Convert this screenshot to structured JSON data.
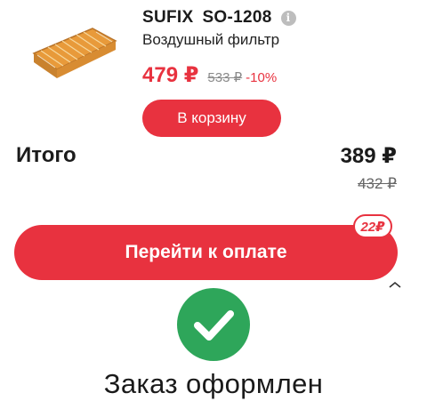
{
  "product": {
    "brand": "SUFIX",
    "sku": "SO-1208",
    "name": "Воздушный фильтр",
    "price_current": "479 ₽",
    "price_old": "533 ₽",
    "discount": "-10%",
    "add_to_cart_label": "В корзину",
    "image_icon": "air-filter-image",
    "info_icon": "info-icon",
    "info_glyph": "i"
  },
  "totals": {
    "label": "Итого",
    "value": "389 ₽",
    "old_value": "432 ₽"
  },
  "checkout": {
    "label": "Перейти к оплате",
    "bonus_badge": "22₽"
  },
  "confirmation": {
    "message": "Заказ оформлен",
    "icon": "check-circle-icon"
  },
  "colors": {
    "accent": "#e8323f",
    "success": "#2ea65a"
  }
}
